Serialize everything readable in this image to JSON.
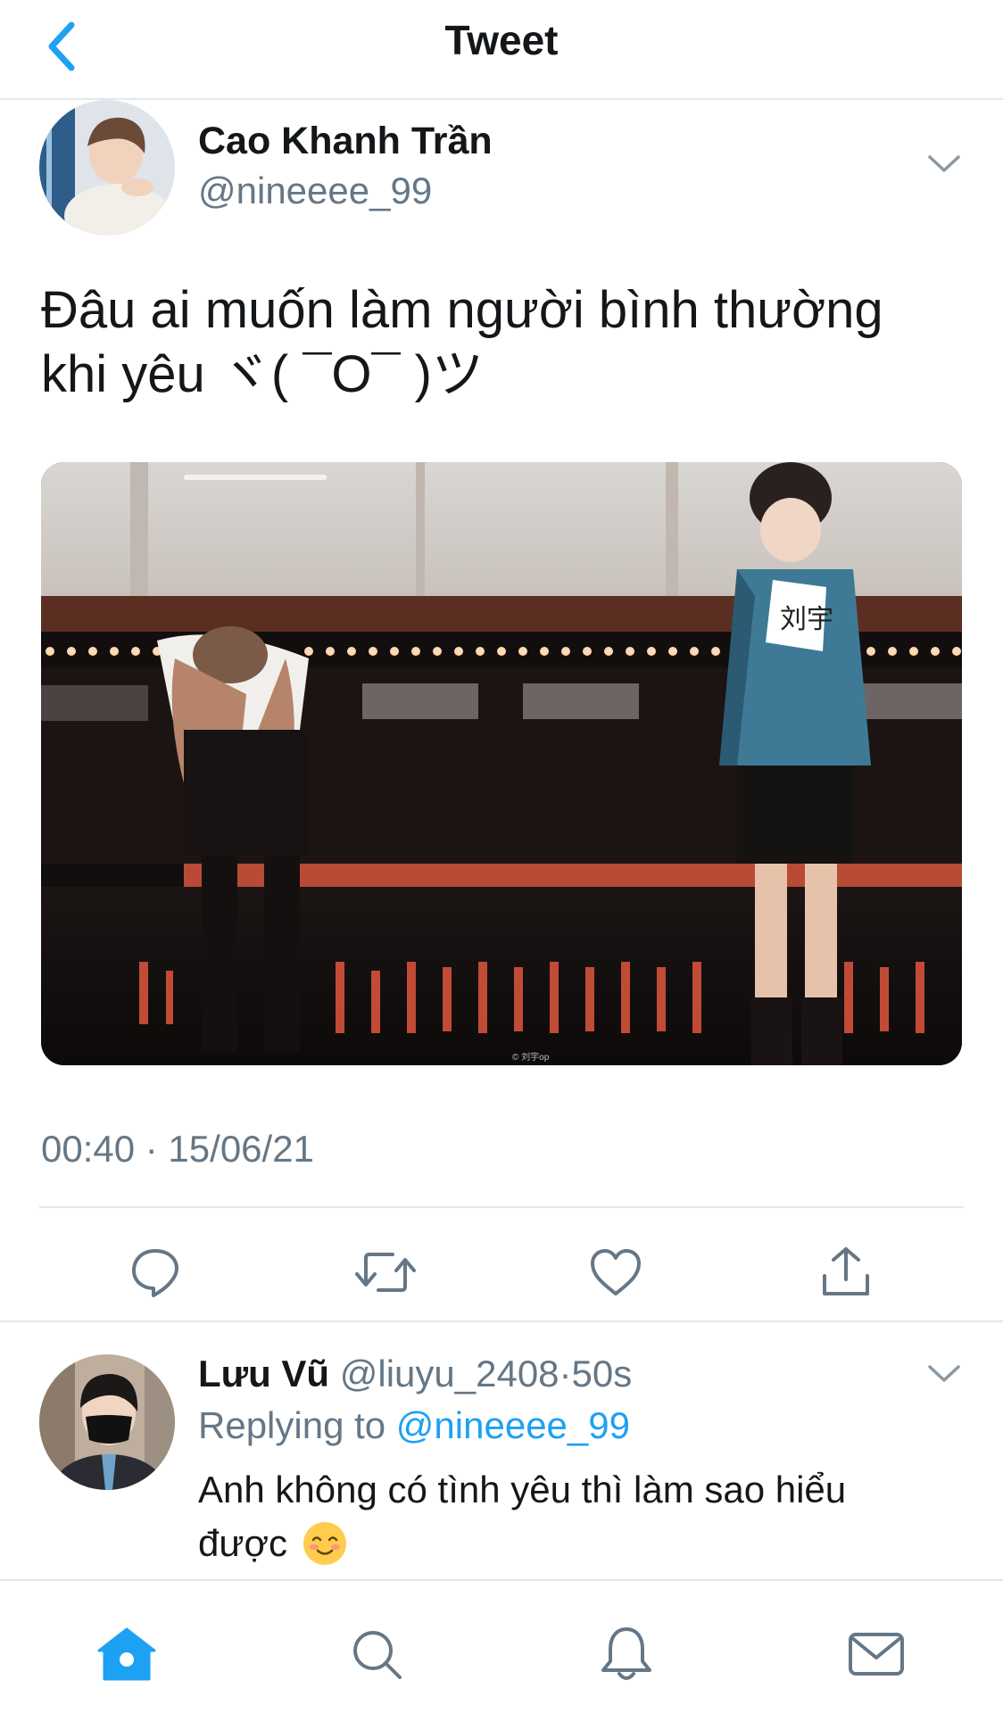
{
  "header": {
    "title": "Tweet",
    "back_icon": "chevron-left-icon"
  },
  "tweet": {
    "author_name": "Cao Khanh Trần",
    "author_handle": "@nineeee_99",
    "text_line1": "Đâu ai muốn làm người bình thường",
    "text_line2": "khi yêu ヾ( ¯O¯ )ツ",
    "timestamp": "00:40 · 15/06/21",
    "media_watermark": "© 刘宇op",
    "media_badge_text": "刘宇"
  },
  "actions": {
    "reply_icon": "comment-icon",
    "retweet_icon": "retweet-icon",
    "like_icon": "heart-icon",
    "share_icon": "share-icon"
  },
  "reply": {
    "author_name": "Lưu Vũ",
    "author_handle": "@liuyu_2408",
    "separator": "·",
    "time": "50s",
    "replying_label": "Replying to ",
    "replying_mention": "@nineeee_99",
    "text_line1": "Anh không có tình yêu thì làm sao hiểu",
    "text_line2": "được"
  },
  "tabbar": {
    "home_icon": "home-icon",
    "search_icon": "search-icon",
    "notifications_icon": "bell-icon",
    "messages_icon": "mail-icon"
  },
  "colors": {
    "accent": "#1da1f2",
    "text_primary": "#14171a",
    "text_secondary": "#657786",
    "divider": "#e1e8ed"
  }
}
